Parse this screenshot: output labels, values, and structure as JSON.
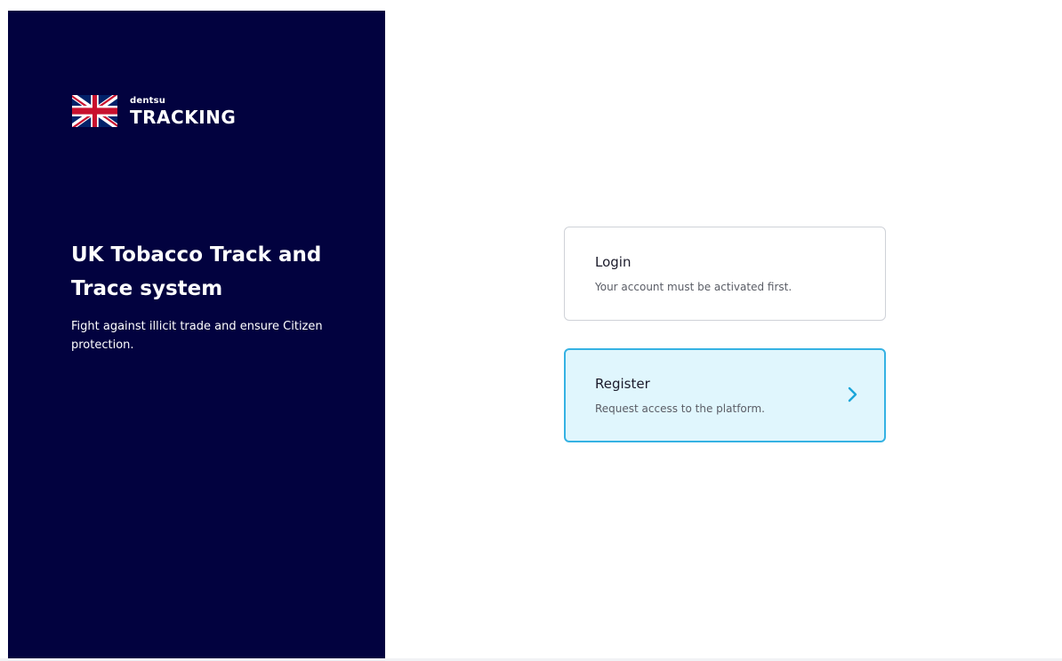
{
  "brand": {
    "small": "dentsu",
    "big": "TRACKING",
    "icon": "uk-flag-icon"
  },
  "hero": {
    "headline": "UK Tobacco Track and Trace system",
    "tagline": "Fight against illicit trade and ensure Citizen protection."
  },
  "options": {
    "login": {
      "title": "Login",
      "subtitle": "Your account must be activated first."
    },
    "register": {
      "title": "Register",
      "subtitle": "Request access to the platform.",
      "icon": "chevron-right-icon"
    }
  },
  "colors": {
    "panel": "#02023f",
    "accent": "#35b2e3",
    "register_bg": "#e0f6fd",
    "flag_blue": "#012169",
    "flag_red": "#c8102e"
  }
}
